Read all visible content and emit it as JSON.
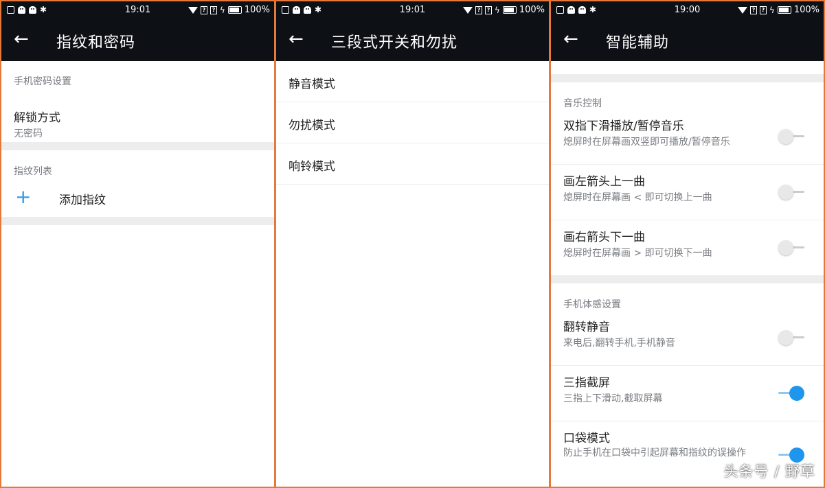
{
  "status_bars": [
    {
      "time": "19:01",
      "battery": "100%"
    },
    {
      "time": "19:01",
      "battery": "100%"
    },
    {
      "time": "19:00",
      "battery": "100%"
    }
  ],
  "panel1": {
    "title": "指纹和密码",
    "section1_header": "手机密码设置",
    "unlock": {
      "title": "解锁方式",
      "subtitle": "无密码"
    },
    "section2_header": "指纹列表",
    "add_fingerprint": "添加指纹"
  },
  "panel2": {
    "title": "三段式开关和勿扰",
    "items": [
      "静音模式",
      "勿扰模式",
      "响铃模式"
    ]
  },
  "panel3": {
    "title": "智能辅助",
    "music_header": "音乐控制",
    "music_items": [
      {
        "title": "双指下滑播放/暂停音乐",
        "subtitle": "熄屏时在屏幕画双竖即可播放/暂停音乐",
        "enabled": false
      },
      {
        "title": "画左箭头上一曲",
        "subtitle": "熄屏时在屏幕画 < 即可切换上一曲",
        "enabled": false
      },
      {
        "title": "画右箭头下一曲",
        "subtitle": "熄屏时在屏幕画 > 即可切换下一曲",
        "enabled": false
      }
    ],
    "motion_header": "手机体感设置",
    "motion_items": [
      {
        "title": "翻转静音",
        "subtitle": "来电后,翻转手机,手机静音",
        "enabled": false
      },
      {
        "title": "三指截屏",
        "subtitle": "三指上下滑动,截取屏幕",
        "enabled": true
      },
      {
        "title": "口袋模式",
        "subtitle": "防止手机在口袋中引起屏幕和指纹的误操作",
        "enabled": true
      }
    ]
  },
  "watermark": "头条号 / 野草",
  "colors": {
    "appbar": "#0d1015",
    "accent": "#1e96ee",
    "border": "#e6783a"
  }
}
